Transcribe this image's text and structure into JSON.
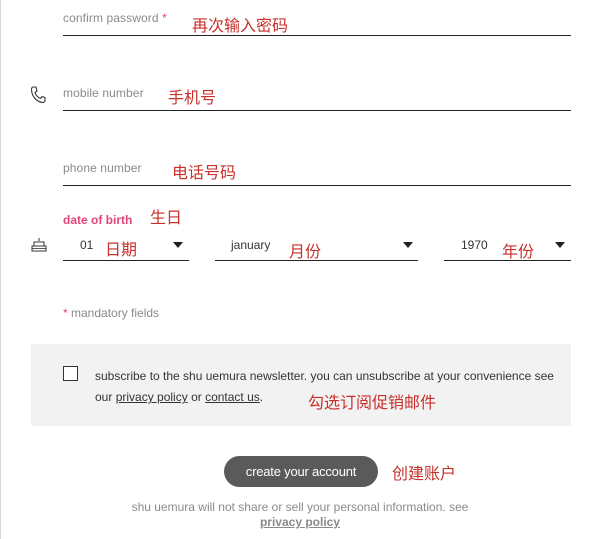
{
  "fields": {
    "confirm_password": {
      "label": "confirm password",
      "required_mark": "*",
      "annotation": "再次输入密码"
    },
    "mobile_number": {
      "label": "mobile number",
      "annotation": "手机号"
    },
    "phone_number": {
      "label": "phone number",
      "annotation": "电话号码"
    }
  },
  "dob": {
    "label": "date of birth",
    "annotation": "生日",
    "day": {
      "value": "01",
      "annotation": "日期"
    },
    "month": {
      "value": "january",
      "annotation": "月份"
    },
    "year": {
      "value": "1970",
      "annotation": "年份"
    }
  },
  "mandatory": {
    "mark": "*",
    "text": "mandatory fields"
  },
  "newsletter": {
    "text_1": "subscribe to the shu uemura newsletter. you can unsubscribe at your convenience see our",
    "privacy_link": "privacy policy",
    "or_text": "or",
    "contact_link": "contact us",
    "period": ".",
    "annotation": "勾选订阅促销邮件"
  },
  "create": {
    "label": "create your account",
    "annotation": "创建账户"
  },
  "footer": {
    "text": "shu uemura will not share or sell your personal information. see",
    "link": "privacy policy"
  }
}
